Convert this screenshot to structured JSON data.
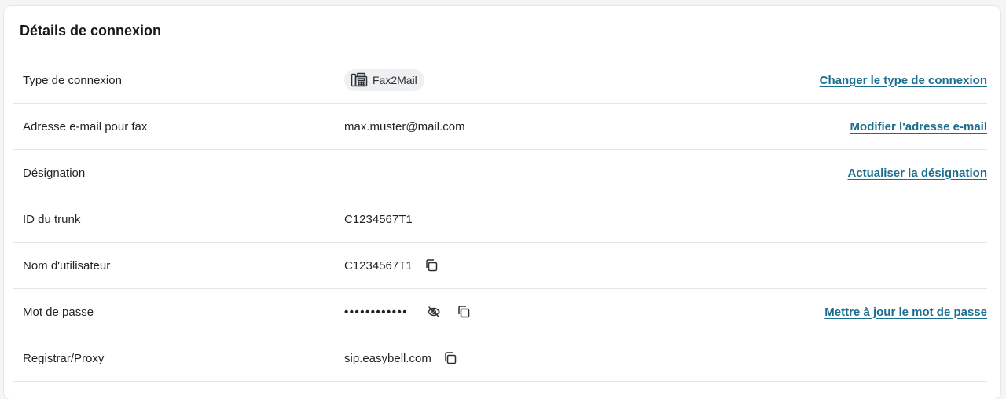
{
  "card": {
    "title": "Détails de connexion"
  },
  "rows": {
    "connection_type": {
      "label": "Type de connexion",
      "value": "Fax2Mail",
      "icon": "fax-icon",
      "action": "Changer le type de connexion"
    },
    "fax_email": {
      "label": "Adresse e-mail pour fax",
      "value": "max.muster@mail.com",
      "action": "Modifier l'adresse e-mail"
    },
    "designation": {
      "label": "Désignation",
      "value": "",
      "action": "Actualiser la désignation"
    },
    "trunk_id": {
      "label": "ID du trunk",
      "value": "C1234567T1"
    },
    "username": {
      "label": "Nom d'utilisateur",
      "value": "C1234567T1",
      "icon": "copy-icon"
    },
    "password": {
      "label": "Mot de passe",
      "value": "••••••••••••",
      "icons": [
        "eye-off-icon",
        "copy-icon"
      ],
      "action": "Mettre à jour le mot de passe"
    },
    "registrar": {
      "label": "Registrar/Proxy",
      "value": "sip.easybell.com",
      "icon": "copy-icon"
    }
  },
  "colors": {
    "link": "#1c6e8f",
    "chip_bg": "#eef0f2",
    "border": "#e4e5e8"
  }
}
